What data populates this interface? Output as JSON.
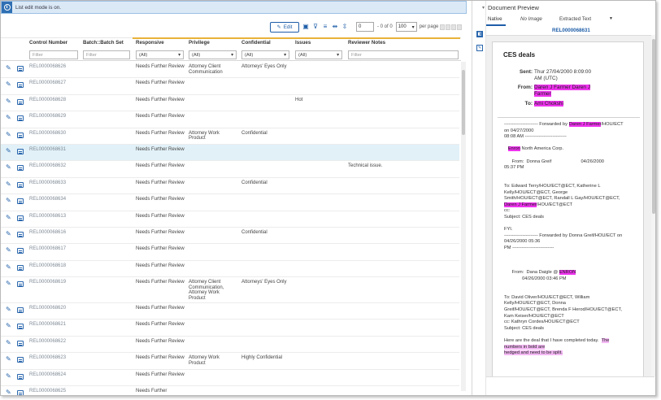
{
  "banner": {
    "icon": "info-icon",
    "text": "List edit mode is on."
  },
  "toolbar": {
    "edit_label": "Edit",
    "icons": [
      "filter-layout-icon",
      "filter-icon",
      "clear-filter-icon",
      "fit-columns-icon",
      "row-height-icon"
    ],
    "page_value": "0",
    "page_of": "- 0 of 0",
    "per_page_value": "100",
    "per_page_label": "per page"
  },
  "grid": {
    "headers": {
      "control_number": "Control Number",
      "batch": "Batch::Batch Set",
      "responsive": "Responsive",
      "privilege": "Privilege",
      "confidential": "Confidential",
      "issues": "Issues",
      "reviewer_notes": "Reviewer Notes"
    },
    "filters": {
      "control_number": "Filter",
      "batch": "Filter",
      "responsive": "(All)",
      "privilege": "(All)",
      "confidential": "(All)",
      "issues": "(All)",
      "reviewer_notes": "Filter"
    },
    "rows": [
      {
        "control": "REL0000068626",
        "responsive": "Needs Further Review",
        "privilege": "Attorney Client Communication",
        "confidential": "Attorneys' Eyes Only",
        "issues": "",
        "notes": ""
      },
      {
        "control": "REL0000068627",
        "responsive": "Needs Further Review",
        "privilege": "",
        "confidential": "",
        "issues": "",
        "notes": ""
      },
      {
        "control": "REL0000068628",
        "responsive": "Needs Further Review",
        "privilege": "",
        "confidential": "",
        "issues": "Hot",
        "notes": ""
      },
      {
        "control": "REL0000068629",
        "responsive": "Needs Further Review",
        "privilege": "",
        "confidential": "",
        "issues": "",
        "notes": ""
      },
      {
        "control": "REL0000068630",
        "responsive": "Needs Further Review",
        "privilege": "Attorney Work Product",
        "confidential": "Confidential",
        "issues": "",
        "notes": ""
      },
      {
        "control": "REL0000068631",
        "responsive": "Needs Further Review",
        "privilege": "",
        "confidential": "",
        "issues": "",
        "notes": ""
      },
      {
        "control": "REL0000068632",
        "responsive": "Needs Further Review",
        "privilege": "",
        "confidential": "",
        "issues": "",
        "notes": "Technical issue."
      },
      {
        "control": "REL0000068633",
        "responsive": "Needs Further Review",
        "privilege": "",
        "confidential": "Confidential",
        "issues": "",
        "notes": ""
      },
      {
        "control": "REL0000068634",
        "responsive": "Needs Further Review",
        "privilege": "",
        "confidential": "",
        "issues": "",
        "notes": ""
      },
      {
        "control": "REL0000068613",
        "responsive": "Needs Further Review",
        "privilege": "",
        "confidential": "",
        "issues": "",
        "notes": ""
      },
      {
        "control": "REL0000068616",
        "responsive": "Needs Further Review",
        "privilege": "",
        "confidential": "Confidential",
        "issues": "",
        "notes": ""
      },
      {
        "control": "REL0000068617",
        "responsive": "Needs Further Review",
        "privilege": "",
        "confidential": "",
        "issues": "",
        "notes": ""
      },
      {
        "control": "REL0000068618",
        "responsive": "Needs Further Review",
        "privilege": "",
        "confidential": "",
        "issues": "",
        "notes": ""
      },
      {
        "control": "REL0000068619",
        "responsive": "Needs Further Review",
        "privilege": "Attorney Client Communication, Attorney Work Product",
        "confidential": "Attorneys' Eyes Only",
        "issues": "",
        "notes": ""
      },
      {
        "control": "REL0000068620",
        "responsive": "Needs Further Review",
        "privilege": "",
        "confidential": "",
        "issues": "",
        "notes": ""
      },
      {
        "control": "REL0000068621",
        "responsive": "Needs Further Review",
        "privilege": "",
        "confidential": "",
        "issues": "",
        "notes": ""
      },
      {
        "control": "REL0000068622",
        "responsive": "Needs Further Review",
        "privilege": "",
        "confidential": "",
        "issues": "",
        "notes": ""
      },
      {
        "control": "REL0000068623",
        "responsive": "Needs Further Review",
        "privilege": "Attorney Work Product",
        "confidential": "Highly Confidential",
        "issues": "",
        "notes": ""
      },
      {
        "control": "REL0000068624",
        "responsive": "Needs Further Review",
        "privilege": "",
        "confidential": "",
        "issues": "",
        "notes": ""
      },
      {
        "control": "REL0000068625",
        "responsive": "Needs Further",
        "privilege": "",
        "confidential": "",
        "issues": "",
        "notes": ""
      }
    ],
    "selected_index": 5
  },
  "preview": {
    "title": "Document Preview",
    "tabs": [
      "Native",
      "No Image",
      "Extracted Text"
    ],
    "active_tab": "Native",
    "doc_id": "REL0000068631",
    "email": {
      "subject": "CES deals",
      "sent_label": "Sent:",
      "sent_value_1": "Thur 27/04/2000 8:09:00",
      "sent_value_2": "AM (UTC)",
      "from_label": "From:",
      "from_value": "Daren J Farmer Daren J Farmer",
      "to_label": "To:",
      "to_value": "Ami Chokshi"
    },
    "body_lines": [
      "---------------------- Forwarded by Daren J Farmer/HOU/ECT",
      "on 04/27/2000",
      "08:08 AM ---------------------------",
      "",
      "   Enron North America Corp.",
      "",
      "      From:  Donna Greif                       04/26/2000",
      "05:37 PM",
      "",
      "",
      "To: Edward Terry/HOU/ECT@ECT, Katherine L",
      "Kelly/HOU/ECT@ECT, George",
      "Smith/HOU/ECT@ECT, Randall L Gay/HOU/ECT@ECT,",
      "Daren J Farmer/HOU/ECT@ECT",
      "cc:",
      "Subject: CES deals",
      "",
      "FYI.",
      "---------------------- Forwarded by Donna Greif/HOU/ECT on",
      "04/26/2000 05:36",
      "PM ---------------------------",
      "",
      "",
      "",
      "      From:  Dana Daigle @ ENRON",
      "              04/26/2000 03:46 PM",
      "",
      "",
      "To: David Oliver/HOU/ECT@ECT, William",
      "Kelly/HOU/ECT@ECT, Donna",
      "Greif/HOU/ECT@ECT, Brenda F Herod/HOU/ECT@ECT,",
      "Kam Keiser/HOU/ECT@ECT",
      "cc: Kathryn Cordes/HOU/ECT@ECT",
      "Subject: CES deals",
      "",
      "Here are the deal that I have completed today.  The",
      "numbers in bold are",
      "hedged and need to be split."
    ]
  },
  "colors": {
    "accent": "#1f5ea8",
    "highlight": "#ee33ee",
    "selected_row": "#e2f1f8",
    "header_line": "#e8b23a"
  }
}
